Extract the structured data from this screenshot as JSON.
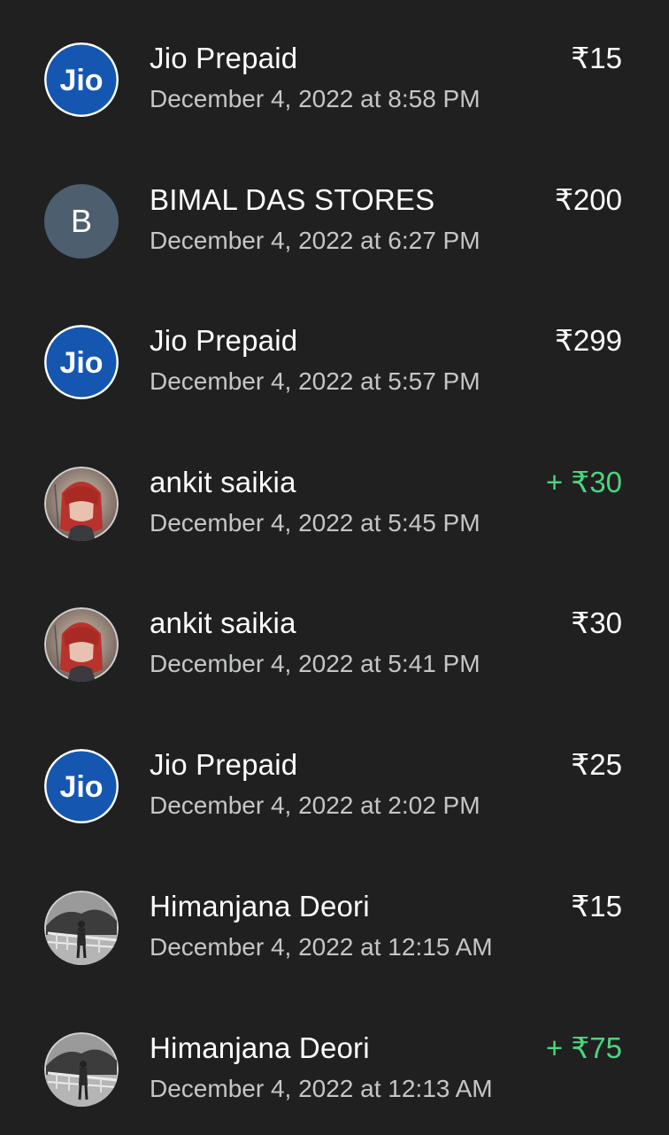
{
  "colors": {
    "background": "#202020",
    "primary_text": "#ffffff",
    "secondary_text": "#c4c7c5",
    "credit_green": "#4ad680",
    "jio_blue": "#1557b0",
    "initial_avatar_bg": "#4d5f6e"
  },
  "transactions": [
    {
      "name": "Jio Prepaid",
      "datetime": "December 4, 2022 at 8:58 PM",
      "amount": "₹15",
      "direction": "debit",
      "avatar": "jio-logo-icon"
    },
    {
      "name": "BIMAL DAS STORES",
      "datetime": "December 4, 2022 at 6:27 PM",
      "amount": "₹200",
      "direction": "debit",
      "avatar": "initial",
      "initial": "B"
    },
    {
      "name": "Jio Prepaid",
      "datetime": "December 4, 2022 at 5:57 PM",
      "amount": "₹299",
      "direction": "debit",
      "avatar": "jio-logo-icon"
    },
    {
      "name": "ankit saikia",
      "datetime": "December 4, 2022 at 5:45 PM",
      "amount": "+ ₹30",
      "direction": "credit",
      "avatar": "photo-red-hair"
    },
    {
      "name": "ankit saikia",
      "datetime": "December 4, 2022 at 5:41 PM",
      "amount": "₹30",
      "direction": "debit",
      "avatar": "photo-red-hair"
    },
    {
      "name": "Jio Prepaid",
      "datetime": "December 4, 2022 at 2:02 PM",
      "amount": "₹25",
      "direction": "debit",
      "avatar": "jio-logo-icon"
    },
    {
      "name": "Himanjana Deori",
      "datetime": "December 4, 2022 at 12:15 AM",
      "amount": "₹15",
      "direction": "debit",
      "avatar": "photo-bridge"
    },
    {
      "name": "Himanjana Deori",
      "datetime": "December 4, 2022 at 12:13 AM",
      "amount": "+ ₹75",
      "direction": "credit",
      "avatar": "photo-bridge"
    }
  ]
}
